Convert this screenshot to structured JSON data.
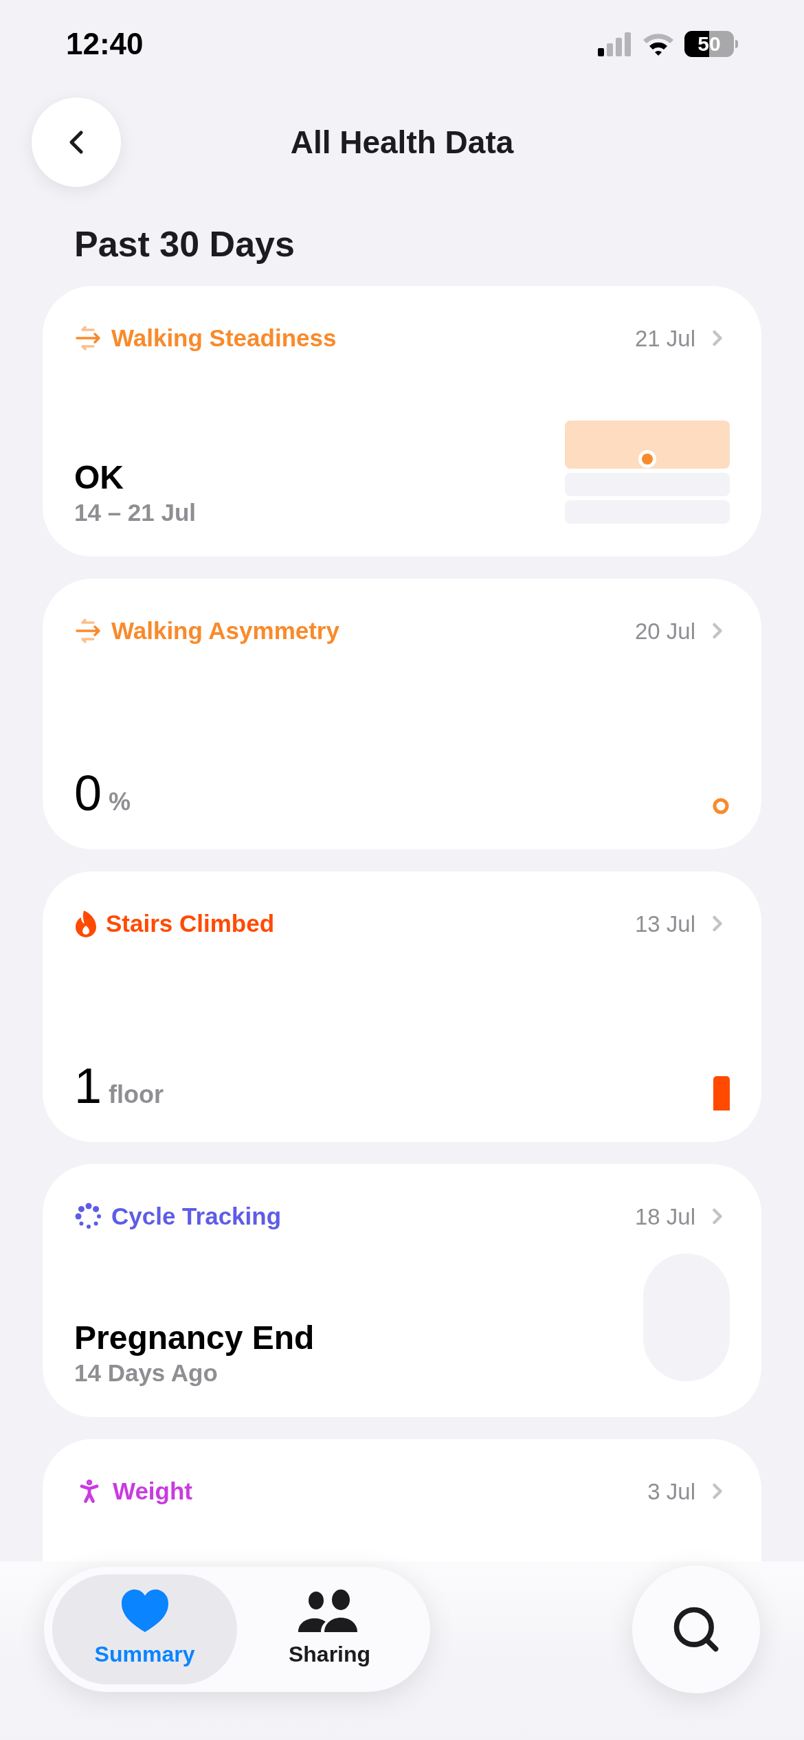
{
  "status_bar": {
    "time": "12:40",
    "battery": "50"
  },
  "header": {
    "title": "All Health Data"
  },
  "section": {
    "title": "Past 30 Days"
  },
  "cards": [
    {
      "kind": "steadiness",
      "title": "Walking Steadiness",
      "date": "21 Jul",
      "color": "#f98a2b",
      "value": "OK",
      "subtitle": "14 – 21 Jul"
    },
    {
      "kind": "asymmetry",
      "title": "Walking Asymmetry",
      "date": "20 Jul",
      "color": "#f98a2b",
      "value": "0",
      "unit": "%"
    },
    {
      "kind": "stairs",
      "title": "Stairs Climbed",
      "date": "13 Jul",
      "color": "#ff4a00",
      "value": "1",
      "unit": "floor"
    },
    {
      "kind": "cycle",
      "title": "Cycle Tracking",
      "date": "18 Jul",
      "color": "#5e5ce6",
      "value": "Pregnancy End",
      "subtitle": "14 Days Ago"
    },
    {
      "kind": "weight",
      "title": "Weight",
      "date": "3 Jul",
      "color": "#c93be0"
    }
  ],
  "tab_bar": {
    "tabs": [
      {
        "kind": "summary",
        "label": "Summary",
        "selected": true
      },
      {
        "kind": "sharing",
        "label": "Sharing",
        "selected": false
      }
    ]
  }
}
